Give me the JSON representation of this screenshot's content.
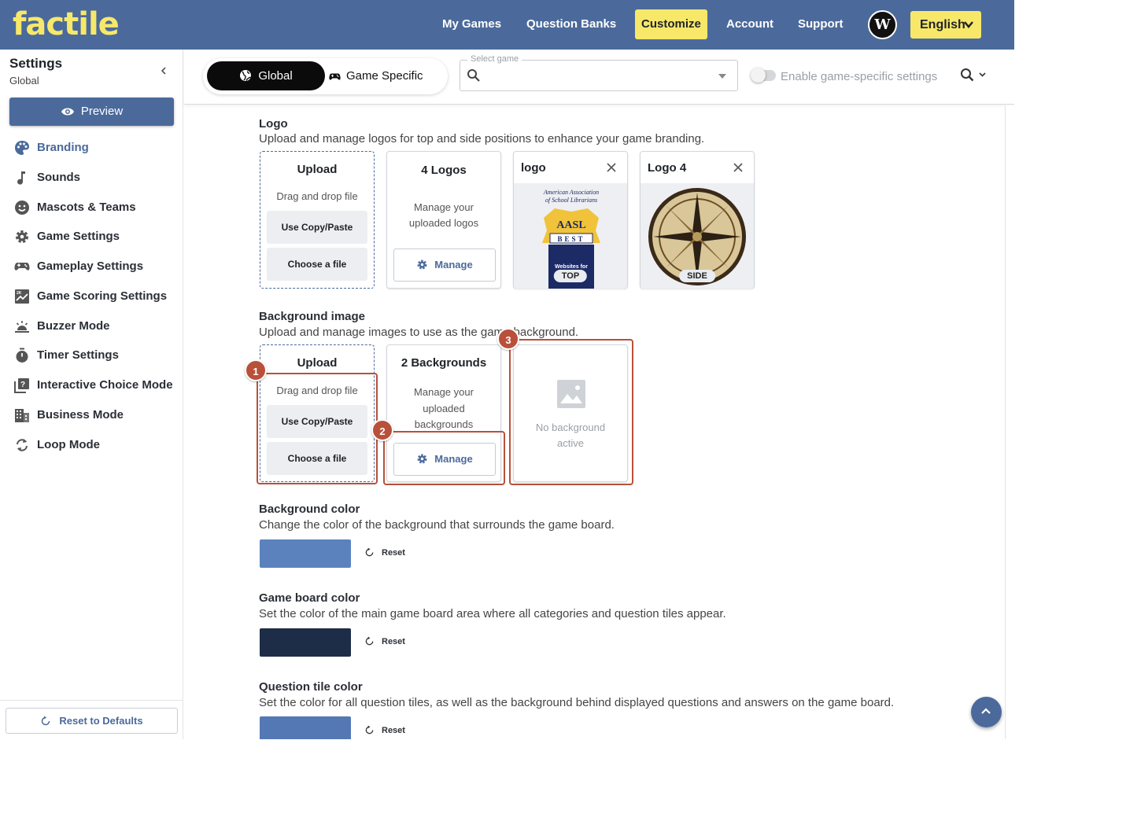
{
  "app": {
    "brand": "factile"
  },
  "topnav": {
    "items": [
      "My Games",
      "Question Banks",
      "Customize",
      "Account",
      "Support"
    ],
    "active": "Customize",
    "avatar_letter": "W",
    "language": "English"
  },
  "sidebar": {
    "title": "Settings",
    "subtitle": "Global",
    "preview_label": "Preview",
    "items": [
      {
        "label": "Branding",
        "icon": "palette-icon",
        "active": true
      },
      {
        "label": "Sounds",
        "icon": "music-note-icon"
      },
      {
        "label": "Mascots & Teams",
        "icon": "smiley-icon"
      },
      {
        "label": "Game Settings",
        "icon": "gear-icon"
      },
      {
        "label": "Gameplay Settings",
        "icon": "gamepad-icon"
      },
      {
        "label": "Game Scoring Settings",
        "icon": "scoring-chart-icon"
      },
      {
        "label": "Buzzer Mode",
        "icon": "buzzer-icon"
      },
      {
        "label": "Timer Settings",
        "icon": "timer-icon"
      },
      {
        "label": "Interactive Choice Mode",
        "icon": "choice-icon"
      },
      {
        "label": "Business Mode",
        "icon": "building-icon"
      },
      {
        "label": "Loop Mode",
        "icon": "loop-icon"
      }
    ],
    "reset_defaults_label": "Reset to Defaults"
  },
  "controlbar": {
    "global_label": "Global",
    "specific_label": "Game Specific",
    "select_game_legend": "Select game",
    "select_game_value": "",
    "toggle_label": "Enable game-specific settings",
    "toggle_on": false
  },
  "logo_section": {
    "title": "Logo",
    "description": "Upload and manage logos for top and side positions to enhance your game branding.",
    "upload_card": {
      "title": "Upload",
      "drag_text": "Drag and drop file",
      "copy_paste": "Use Copy/Paste",
      "choose_file": "Choose a file"
    },
    "manage_card": {
      "title": "4 Logos",
      "line1": "Manage your",
      "line2": "uploaded logos",
      "button": "Manage"
    },
    "logo_cards": [
      {
        "name": "logo",
        "position_badge": "TOP",
        "image_text": [
          "American Association",
          "of School Librarians",
          "AASL",
          "BEST",
          "Websites for"
        ]
      },
      {
        "name": "Logo 4",
        "position_badge": "SIDE"
      }
    ]
  },
  "background_section": {
    "title": "Background image",
    "description": "Upload and manage images to use as the game background.",
    "upload_card": {
      "title": "Upload",
      "drag_text": "Drag and drop file",
      "copy_paste": "Use Copy/Paste",
      "choose_file": "Choose a file"
    },
    "manage_card": {
      "title": "2 Backgrounds",
      "line1": "Manage your",
      "line2": "uploaded",
      "line3": "backgrounds",
      "button": "Manage"
    },
    "active_card": {
      "line1": "No background",
      "line2": "active"
    }
  },
  "annotations": [
    "1",
    "2",
    "3"
  ],
  "colors_sections": [
    {
      "title": "Background color",
      "description": "Change the color of the background that surrounds the game board.",
      "color": "#5b82bd",
      "reset": "Reset"
    },
    {
      "title": "Game board color",
      "description": "Set the color of the main game board area where all categories and question tiles appear.",
      "color": "#1e2d47",
      "reset": "Reset"
    },
    {
      "title": "Question tile color",
      "description": "Set the color for all question tiles, as well as the background behind displayed questions and answers on the game board.",
      "color": "#5478b4",
      "reset": "Reset"
    }
  ],
  "theme": {
    "accent": "#4b6a9b",
    "brand_yellow": "#f7e86a",
    "annotation": "#b9503a"
  }
}
